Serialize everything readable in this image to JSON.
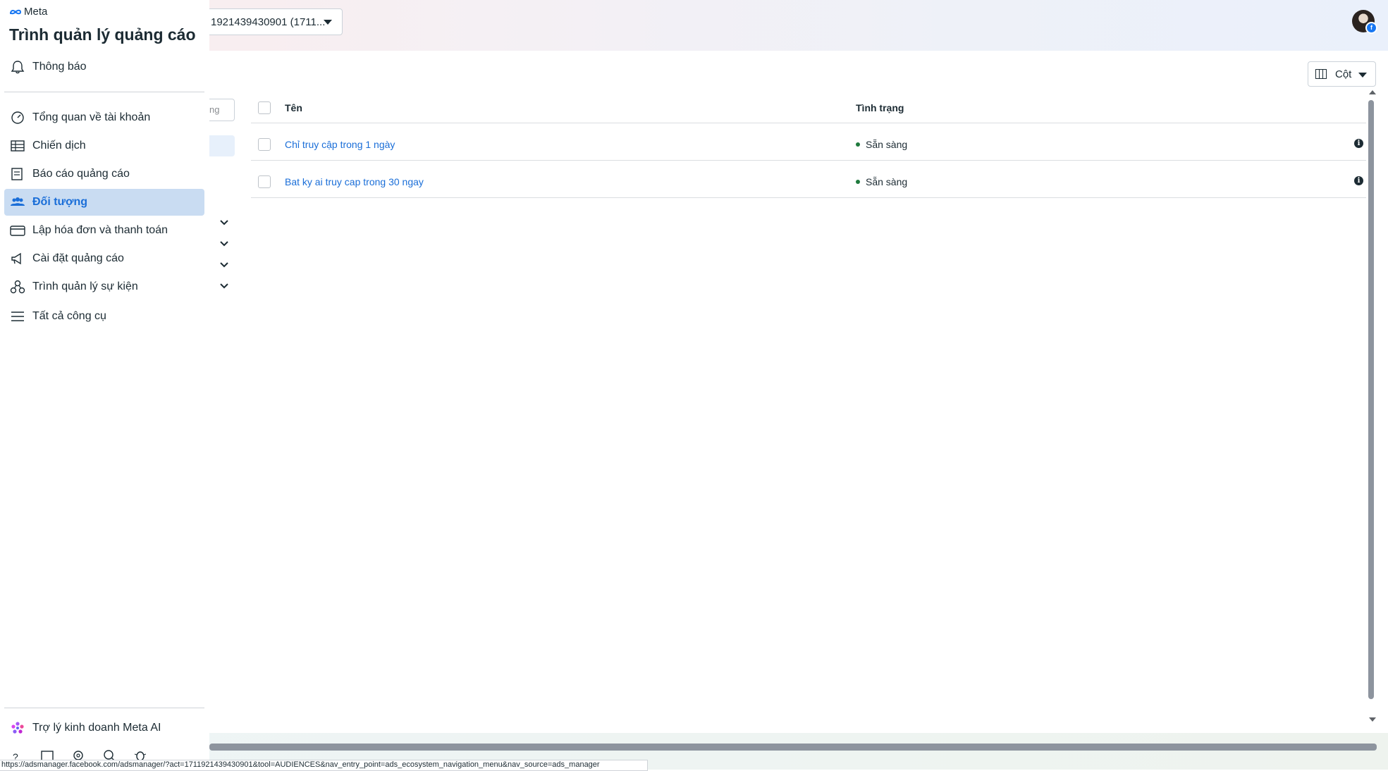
{
  "header": {
    "account_selector": "1921439430901 (1711...",
    "columns_button": "Cột"
  },
  "sidebar": {
    "brand": "Meta",
    "app_title": "Trình quản lý quảng cáo",
    "notifications": "Thông báo",
    "items": [
      {
        "label": "Tổng quan về tài khoản",
        "icon": "gauge-icon"
      },
      {
        "label": "Chiến dịch",
        "icon": "table-icon"
      },
      {
        "label": "Báo cáo quảng cáo",
        "icon": "report-icon"
      },
      {
        "label": "Đối tượng",
        "icon": "people-icon",
        "active": true
      },
      {
        "label": "Lập hóa đơn và thanh toán",
        "icon": "card-icon"
      },
      {
        "label": "Cài đặt quảng cáo",
        "icon": "megaphone-icon"
      },
      {
        "label": "Trình quản lý sự kiện",
        "icon": "events-icon"
      },
      {
        "label": "Tất cả công cụ",
        "icon": "menu-icon"
      }
    ],
    "meta_ai": "Trợ lý kinh doanh Meta AI",
    "clipped_search_text": "ng"
  },
  "table": {
    "columns": [
      "Tên",
      "Tình trạng"
    ],
    "rows": [
      {
        "name": "Chỉ truy cập trong 1 ngày",
        "status": "Sẵn sàng"
      },
      {
        "name": "Bat ky ai truy cap trong 30 ngay",
        "status": "Sẵn sàng"
      }
    ]
  },
  "status_bar": {
    "url": "https://adsmanager.facebook.com/adsmanager/?act=1711921439430901&tool=AUDIENCES&nav_entry_point=ads_ecosystem_navigation_menu&nav_source=ads_manager"
  },
  "colors": {
    "accent": "#1a6ed8",
    "active_bg": "#c9dcf2",
    "status_ready": "#1f7a3d"
  }
}
